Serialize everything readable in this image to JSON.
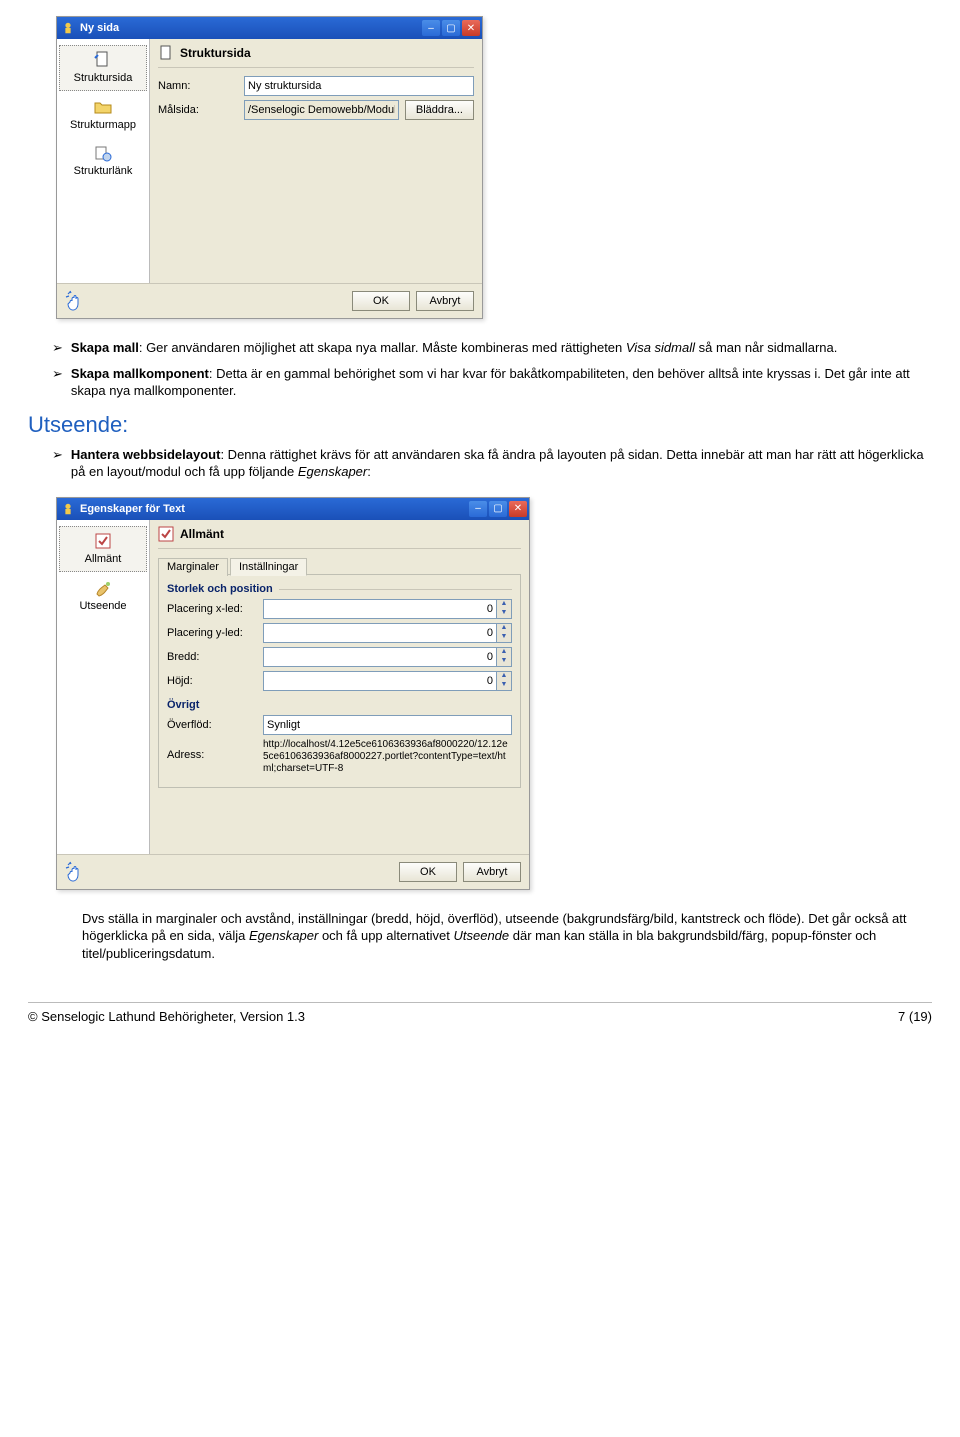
{
  "dialog1": {
    "title": "Ny sida",
    "sidebar": [
      {
        "label": "Struktursida"
      },
      {
        "label": "Strukturmapp"
      },
      {
        "label": "Strukturlänk"
      }
    ],
    "panel_title": "Struktursida",
    "name_label": "Namn:",
    "name_value": "Ny struktursida",
    "target_label": "Målsida:",
    "target_value": "/Senselogic Demowebb/Moduldemo",
    "browse_btn": "Bläddra...",
    "ok": "OK",
    "cancel": "Avbryt"
  },
  "bullets": {
    "b1_bold": "Skapa mall",
    "b1_rest": ": Ger användaren möjlighet att skapa nya mallar. Måste kombineras med rättigheten ",
    "b1_em": "Visa sidmall",
    "b1_tail": " så man når sidmallarna.",
    "b2_bold": "Skapa mallkomponent",
    "b2_rest": ": Detta är en gammal behörighet som vi har kvar för bakåtkompabiliteten, den behöver alltså inte kryssas i. Det går inte att skapa nya mallkomponenter.",
    "section": "Utseende:",
    "b3_bold": "Hantera webbsidelayout",
    "b3_rest": ": Denna rättighet krävs för att användaren ska få ändra på layouten på sidan. Detta innebär att man har rätt att högerklicka på en layout/modul och få upp följande ",
    "b3_em": "Egenskaper",
    "b3_tail": ":"
  },
  "dialog2": {
    "title": "Egenskaper för Text",
    "sidebar": [
      {
        "label": "Allmänt"
      },
      {
        "label": "Utseende"
      }
    ],
    "panel_title": "Allmänt",
    "tab1": "Marginaler",
    "tab2": "Inställningar",
    "group_pos": "Storlek och position",
    "px_label": "Placering x-led:",
    "py_label": "Placering y-led:",
    "w_label": "Bredd:",
    "h_label": "Höjd:",
    "zero": "0",
    "group_other": "Övrigt",
    "overflow_label": "Överflöd:",
    "overflow_value": "Synligt",
    "address_label": "Adress:",
    "address_value": "http://localhost/4.12e5ce6106363936af8000220/12.12e5ce6106363936af8000227.portlet?contentType=text/html;charset=UTF-8",
    "ok": "OK",
    "cancel": "Avbryt"
  },
  "post": {
    "p1": "Dvs ställa in marginaler och avstånd, inställningar (bredd, höjd, överflöd), utseende (bakgrundsfärg/bild, kantstreck och flöde). Det går också att högerklicka på en sida, välja ",
    "p1_em1": "Egenskaper",
    "p1_mid": " och få upp alternativet ",
    "p1_em2": "Utseende",
    "p1_tail": " där man kan ställa in bla bakgrundsbild/färg, popup-fönster och titel/publiceringsdatum."
  },
  "footer": {
    "left": "© Senselogic Lathund Behörigheter, Version 1.3",
    "right": "7 (19)"
  }
}
